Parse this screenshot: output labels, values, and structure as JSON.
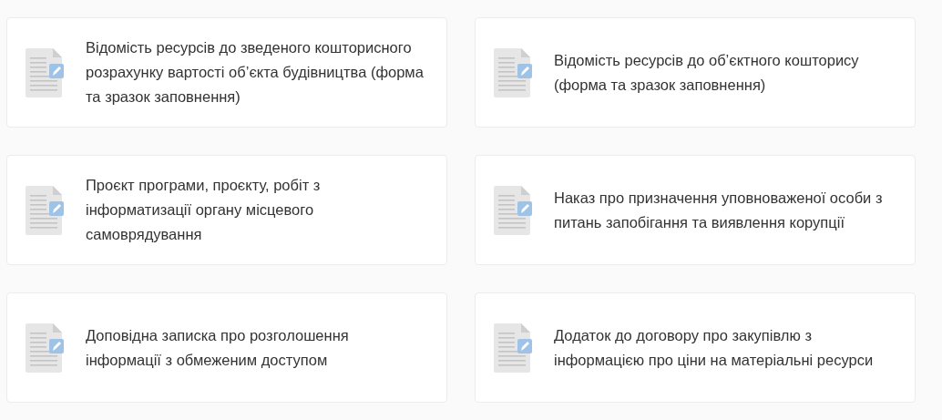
{
  "documents": [
    {
      "title": "Відомість ресурсів до зведеного кошторисного розрахунку вартості об’єкта будівництва (форма та зразок заповнення)"
    },
    {
      "title": "Відомість ресурсів до об’єктного кошторису (форма та зразок заповнення)"
    },
    {
      "title": "Проєкт програми, проєкту, робіт з інформатизації органу місцевого самоврядування"
    },
    {
      "title": "Наказ про призначення уповноваженої особи з питань запобігання та виявлення корупції"
    },
    {
      "title": "Доповідна записка про розголошення інформації з обмеженим доступом"
    },
    {
      "title": "Додаток до договору про закупівлю з інформацією про ціни на матеріальні ресурси"
    }
  ]
}
